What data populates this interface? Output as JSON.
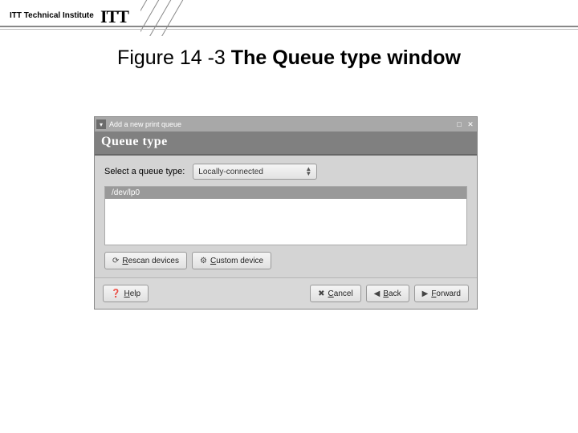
{
  "header": {
    "org": "ITT Technical Institute",
    "logo": "ITT"
  },
  "caption": {
    "prefix": "Figure 14 -3 ",
    "title": "The Queue type window"
  },
  "window": {
    "title": "Add a new print queue",
    "sub_title": "Queue type",
    "select_label": "Select a queue type:",
    "select_value": "Locally-connected",
    "list_selected": "/dev/lp0",
    "buttons": {
      "rescan_pre": "R",
      "rescan_rest": "escan devices",
      "custom_pre": "C",
      "custom_rest": "ustom device",
      "help_pre": "H",
      "help_rest": "elp",
      "cancel_pre": "C",
      "cancel_rest": "ancel",
      "back_pre": "B",
      "back_rest": "ack",
      "forward_pre": "F",
      "forward_rest": "orward"
    }
  }
}
